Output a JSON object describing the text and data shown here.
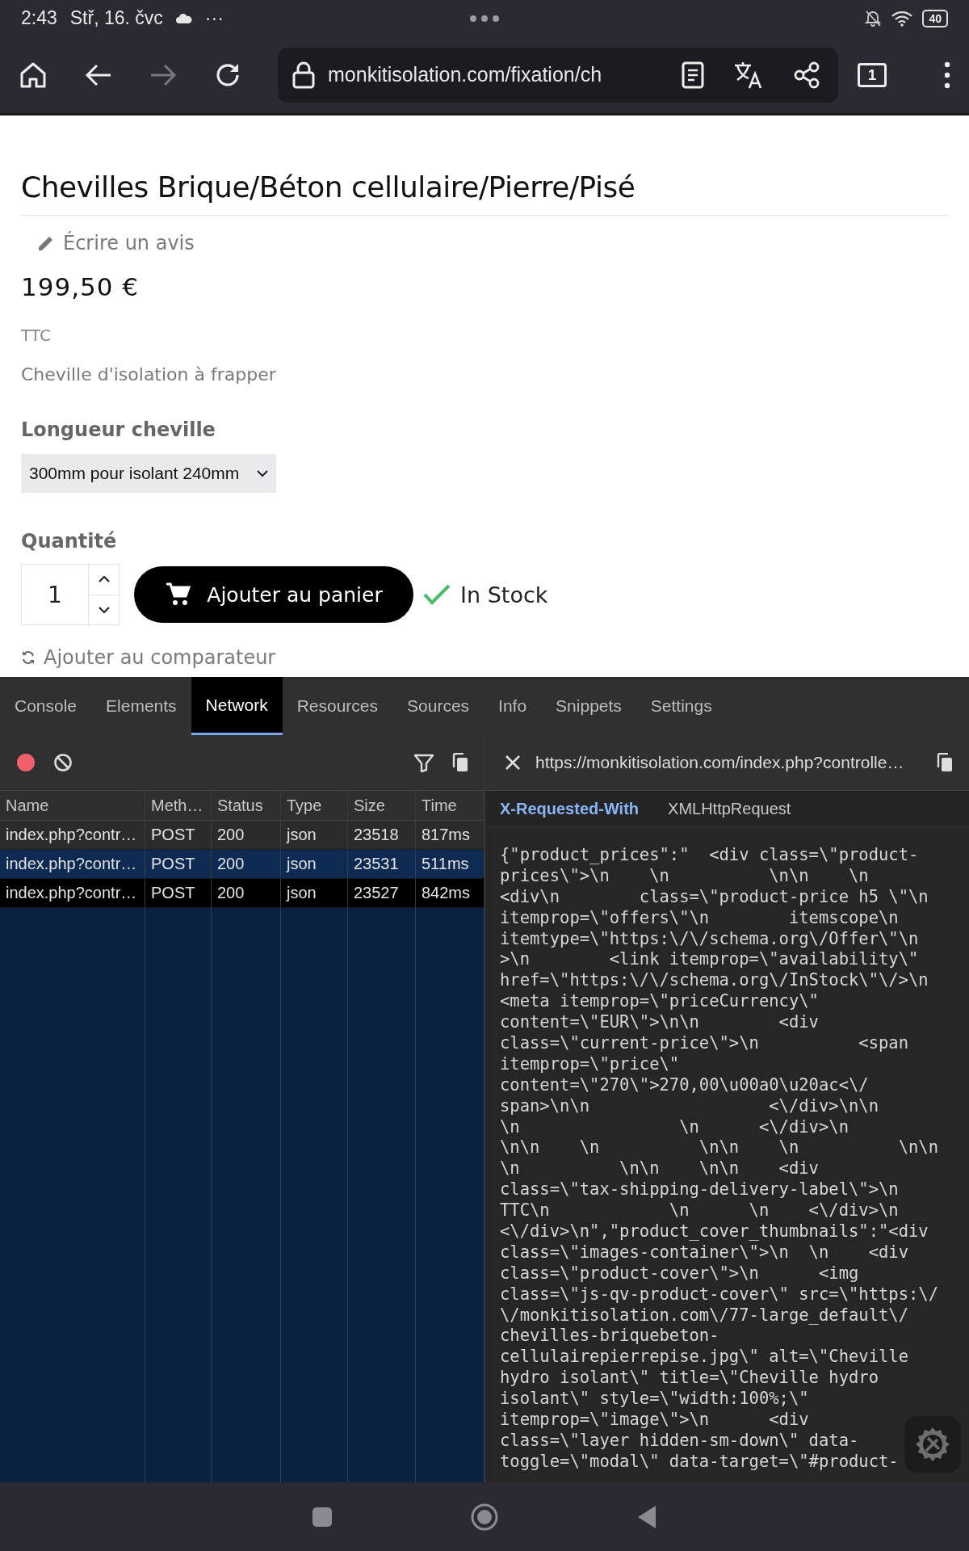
{
  "status_bar": {
    "time": "2:43",
    "date": "Stř, 16. čvc",
    "more": "···",
    "battery": "40"
  },
  "browser_toolbar": {
    "url": "monkitisolation.com/fixation/ch",
    "tab_count": "1"
  },
  "product": {
    "title": "Chevilles Brique/Béton cellulaire/Pierre/Pisé",
    "review_link": "Écrire un avis",
    "price": "199,50 €",
    "tax_label": "TTC",
    "description": "Cheville d'isolation à frapper",
    "option_label": "Longueur cheville",
    "option_value": "300mm pour isolant 240mm",
    "quantity_label": "Quantité",
    "quantity": "1",
    "add_to_cart": "Ajouter au panier",
    "availability": "In Stock",
    "compare_link": "Ajouter au comparateur"
  },
  "devtools": {
    "tabs": [
      {
        "label": "Console",
        "selected": false
      },
      {
        "label": "Elements",
        "selected": false
      },
      {
        "label": "Network",
        "selected": true
      },
      {
        "label": "Resources",
        "selected": false
      },
      {
        "label": "Sources",
        "selected": false
      },
      {
        "label": "Info",
        "selected": false
      },
      {
        "label": "Snippets",
        "selected": false
      },
      {
        "label": "Settings",
        "selected": false
      }
    ],
    "columns": [
      "Name",
      "Meth…",
      "Status",
      "Type",
      "Size",
      "Time"
    ],
    "requests": [
      {
        "cells": [
          "index.php?contr…",
          "POST",
          "200",
          "json",
          "23518",
          "817ms"
        ],
        "selected": false
      },
      {
        "cells": [
          "index.php?contr…",
          "POST",
          "200",
          "json",
          "23531",
          "511ms"
        ],
        "selected": true
      },
      {
        "cells": [
          "index.php?contr…",
          "POST",
          "200",
          "json",
          "23527",
          "842ms"
        ],
        "selected": false
      }
    ],
    "detail": {
      "url": "https://monkitisolation.com/index.php?controlle…",
      "header_name": "X-Requested-With",
      "header_value": "XMLHttpRequest",
      "body_lines": [
        "{\"product_prices\":\"  <div class=\\\"product-",
        "prices\\\">\\n    \\n          \\n\\n    \\n",
        "<div\\n        class=\\\"product-price h5 \\\"\\n",
        "itemprop=\\\"offers\\\"\\n        itemscope\\n",
        "itemtype=\\\"https:\\/\\/schema.org\\/Offer\\\"\\n",
        ">\\n        <link itemprop=\\\"availability\\\"",
        "href=\\\"https:\\/\\/schema.org\\/InStock\\\"\\/>\\n",
        "<meta itemprop=\\\"priceCurrency\\\"",
        "content=\\\"EUR\\\">\\n\\n        <div",
        "class=\\\"current-price\\\">\\n          <span",
        "itemprop=\\\"price\\\"",
        "content=\\\"270\\\">270,00\\u00a0\\u20ac<\\/",
        "span>\\n\\n                  <\\/div>\\n\\n",
        "\\n                \\n      <\\/div>\\n",
        "\\n\\n    \\n          \\n\\n    \\n          \\n\\n",
        "\\n          \\n\\n    \\n\\n    <div",
        "class=\\\"tax-shipping-delivery-label\\\">\\n",
        "TTC\\n            \\n      \\n    <\\/div>\\n",
        "<\\/div>\\n\",\"product_cover_thumbnails\":\"<div",
        "class=\\\"images-container\\\">\\n  \\n    <div",
        "class=\\\"product-cover\\\">\\n      <img",
        "class=\\\"js-qv-product-cover\\\" src=\\\"https:\\/",
        "\\/monkitisolation.com\\/77-large_default\\/",
        "chevilles-briquebeton-",
        "cellulairepierrepise.jpg\\\" alt=\\\"Cheville",
        "hydro isolant\\\" title=\\\"Cheville hydro",
        "isolant\\\" style=\\\"width:100%;\\\"",
        "itemprop=\\\"image\\\">\\n      <div",
        "class=\\\"layer hidden-sm-down\\\" data-",
        "toggle=\\\"modal\\\" data-target=\\\"#product-"
      ]
    }
  }
}
